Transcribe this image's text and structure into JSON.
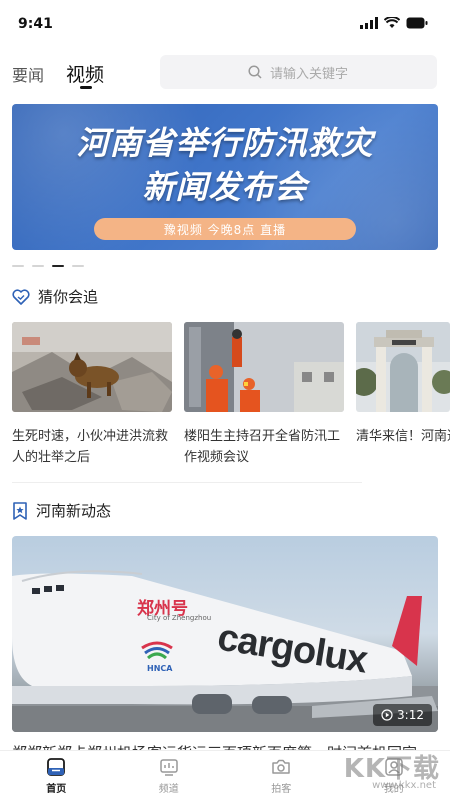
{
  "status_bar": {
    "time": "9:41"
  },
  "top_tabs": {
    "news": "要闻",
    "video": "视频"
  },
  "search": {
    "placeholder": "请输入关键字"
  },
  "banner": {
    "title_line1": "河南省举行防汛救灾",
    "title_line2": "新闻发布会",
    "subtitle": "豫视频  今晚8点  直播"
  },
  "carousel": {
    "count": 4,
    "active_index": 2
  },
  "sections": {
    "guess": {
      "title": "猜你会追",
      "icon": "heart-icon"
    },
    "henan": {
      "title": "河南新动态",
      "icon": "star-bookmark-icon"
    }
  },
  "cards": [
    {
      "text": "生死时速，小伙冲进洪流救人的壮举之后",
      "image": "rescue-dog"
    },
    {
      "text": "楼阳生主持召开全省防汛工作视频会议",
      "image": "rescue-workers"
    },
    {
      "text": "清华来信！河南通知书送达逍遥...",
      "image": "tsinghua-gate"
    }
  ],
  "feature": {
    "aircraft_text": "cargolux",
    "aircraft_cn": "郑州号",
    "aircraft_small": "City of Zhengzhou",
    "logo_text": "HNCA",
    "duration": "3:12",
    "caption": "郑郑新郑卡郑州机场客运货运三百项新百度第一时间首机回家"
  },
  "bottom_nav": [
    {
      "label": "首页",
      "icon": "home-icon",
      "active": true
    },
    {
      "label": "频道",
      "icon": "tv-channel-icon",
      "active": false
    },
    {
      "label": "拍客",
      "icon": "camera-icon",
      "active": false
    },
    {
      "label": "我的",
      "icon": "profile-icon",
      "active": false
    }
  ],
  "watermark": {
    "text": "KK下载",
    "url": "www.kkx.net"
  },
  "colors": {
    "accent": "#2f62b6",
    "banner_pill": "#f4b486",
    "text": "#222222",
    "muted": "#999999"
  }
}
